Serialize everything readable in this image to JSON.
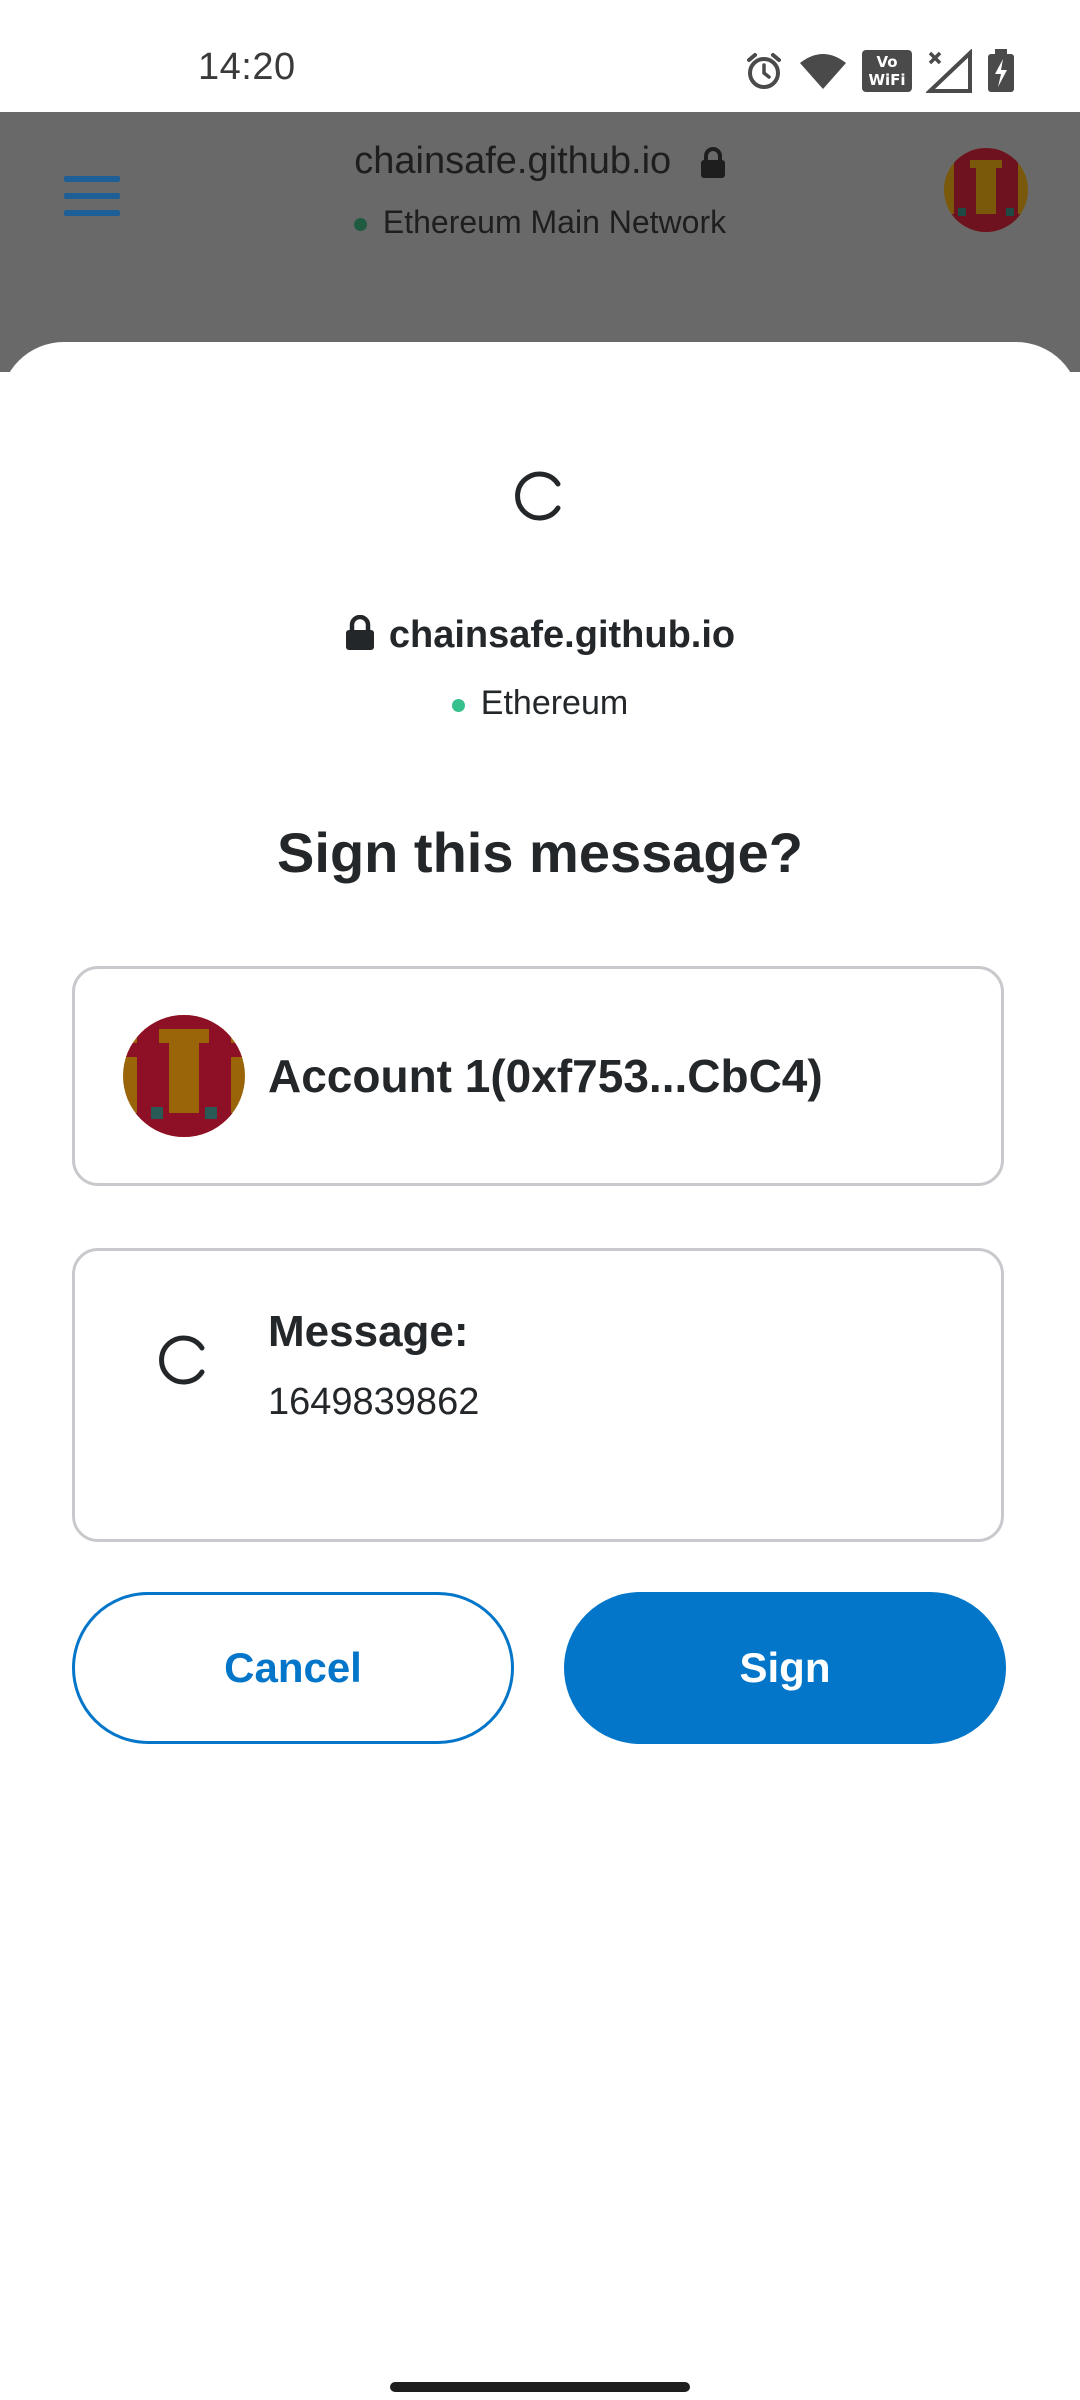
{
  "status_bar": {
    "time": "14:20",
    "volte_line1": "Vo",
    "volte_line2": "WiFi",
    "icons": [
      "alarm-icon",
      "wifi-icon",
      "volte-wifi-icon",
      "signal-icon",
      "battery-charging-icon"
    ]
  },
  "browser_header": {
    "title": "chainsafe.github.io",
    "network": "Ethereum Main Network",
    "menu_icon": "hamburger-icon",
    "lock_icon": "lock-icon"
  },
  "dialog": {
    "site": "chainsafe.github.io",
    "network": "Ethereum",
    "title": "Sign this message?",
    "account_label": "Account 1(0xf753...CbC4)",
    "message_label": "Message:",
    "message_value": "1649839862",
    "cancel_label": "Cancel",
    "sign_label": "Sign"
  },
  "colors": {
    "accent": "#0376c9",
    "network_dot": "#35c08e",
    "overlay": "#696969"
  }
}
